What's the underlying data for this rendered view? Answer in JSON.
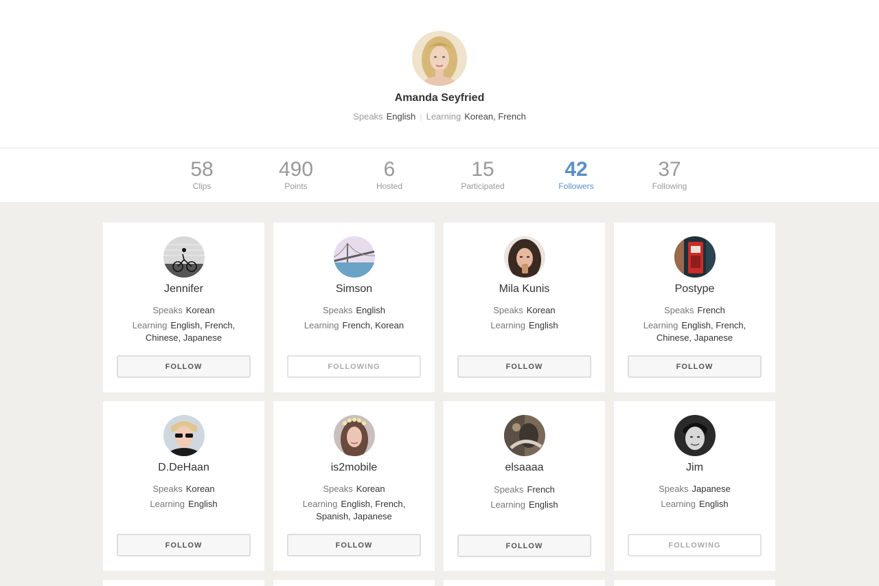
{
  "profile": {
    "name": "Amanda Seyfried",
    "speaks_label": "Speaks",
    "speaks": "English",
    "learning_label": "Learning",
    "learning": "Korean, French",
    "separator": "|"
  },
  "stats": [
    {
      "value": "58",
      "label": "Clips",
      "active": false
    },
    {
      "value": "490",
      "label": "Points",
      "active": false
    },
    {
      "value": "6",
      "label": "Hosted",
      "active": false
    },
    {
      "value": "15",
      "label": "Participated",
      "active": false
    },
    {
      "value": "42",
      "label": "Followers",
      "active": true
    },
    {
      "value": "37",
      "label": "Following",
      "active": false
    }
  ],
  "labels": {
    "speaks": "Speaks",
    "learning": "Learning"
  },
  "users": [
    {
      "name": "Jennifer",
      "speaks": "Korean",
      "learning": "English, French,",
      "learning2": "Chinese, Japanese",
      "button": "FOLLOW",
      "following": false
    },
    {
      "name": "Simson",
      "speaks": "English",
      "learning": "French, Korean",
      "learning2": "",
      "button": "FOLLOWING",
      "following": true
    },
    {
      "name": "Mila Kunis",
      "speaks": "Korean",
      "learning": "English",
      "learning2": "",
      "button": "FOLLOW",
      "following": false
    },
    {
      "name": "Postype",
      "speaks": "French",
      "learning": "English, French,",
      "learning2": "Chinese, Japanese",
      "button": "FOLLOW",
      "following": false
    },
    {
      "name": "D.DeHaan",
      "speaks": "Korean",
      "learning": "English",
      "learning2": "",
      "button": "FOLLOW",
      "following": false
    },
    {
      "name": "is2mobile",
      "speaks": "Korean",
      "learning": "English, French,",
      "learning2": "Spanish, Japanese",
      "button": "FOLLOW",
      "following": false
    },
    {
      "name": "elsaaaa",
      "speaks": "French",
      "learning": "English",
      "learning2": "",
      "button": "FOLLOW",
      "following": false
    },
    {
      "name": "Jim",
      "speaks": "Japanese",
      "learning": "English",
      "learning2": "",
      "button": "FOLLOWING",
      "following": true
    }
  ],
  "colors": {
    "accent": "#5b8fc7",
    "background": "#f0efeb",
    "card": "#ffffff"
  }
}
